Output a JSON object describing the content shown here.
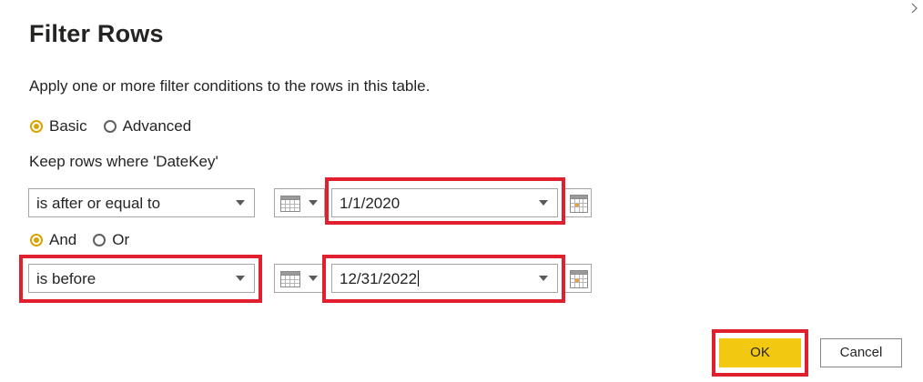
{
  "dialog": {
    "title": "Filter Rows",
    "description": "Apply one or more filter conditions to the rows in this table.",
    "close_icon": "close-icon"
  },
  "mode": {
    "options": [
      {
        "label": "Basic",
        "checked": true
      },
      {
        "label": "Advanced",
        "checked": false
      }
    ]
  },
  "keep_label": "Keep rows where 'DateKey'",
  "condition1": {
    "operator": "is after or equal to",
    "value_type_icon": "calendar-table-icon",
    "value": "1/1/2020",
    "date_picker_icon": "calendar-icon"
  },
  "logic": {
    "options": [
      {
        "label": "And",
        "checked": true
      },
      {
        "label": "Or",
        "checked": false
      }
    ]
  },
  "condition2": {
    "operator": "is before",
    "value_type_icon": "calendar-table-icon",
    "value": "12/31/2022",
    "date_picker_icon": "calendar-icon"
  },
  "buttons": {
    "ok": "OK",
    "cancel": "Cancel"
  },
  "colors": {
    "accent": "#f2c811",
    "radio_checked": "#d6a500",
    "highlight": "#e0202e"
  }
}
